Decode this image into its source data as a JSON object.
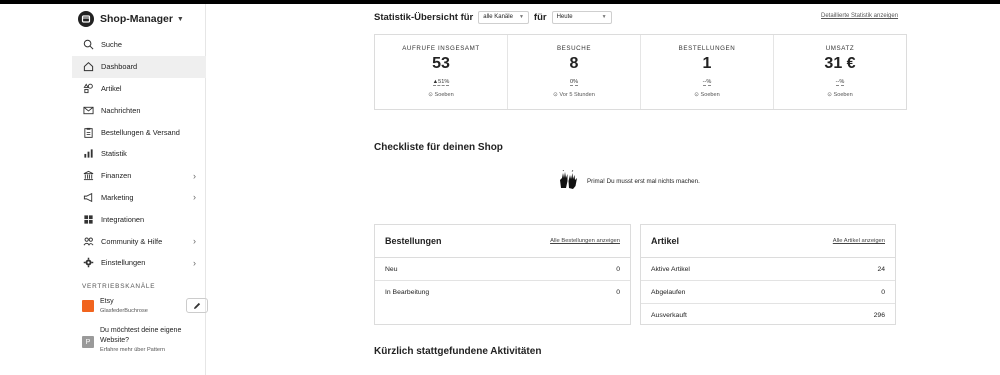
{
  "app": {
    "title": "Shop-Manager"
  },
  "sidebar": {
    "items": [
      {
        "label": "Suche",
        "icon": "search-icon"
      },
      {
        "label": "Dashboard",
        "icon": "home-icon",
        "active": true
      },
      {
        "label": "Artikel",
        "icon": "shapes-icon"
      },
      {
        "label": "Nachrichten",
        "icon": "mail-icon"
      },
      {
        "label": "Bestellungen & Versand",
        "icon": "clipboard-icon"
      },
      {
        "label": "Statistik",
        "icon": "bar-chart-icon"
      },
      {
        "label": "Finanzen",
        "icon": "bank-icon",
        "chevron": "›"
      },
      {
        "label": "Marketing",
        "icon": "megaphone-icon",
        "chevron": "›"
      },
      {
        "label": "Integrationen",
        "icon": "grid-icon"
      },
      {
        "label": "Community & Hilfe",
        "icon": "people-icon",
        "chevron": "›"
      },
      {
        "label": "Einstellungen",
        "icon": "gear-icon",
        "chevron": "›"
      }
    ],
    "section_label": "VERTRIEBSKANÄLE",
    "channel": {
      "name": "Etsy",
      "sub": "GlasfederBuchrose"
    },
    "promo": {
      "badge": "P",
      "text": "Du möchtest deine eigene Website?",
      "sub": "Erfahre mehr über Pattern"
    }
  },
  "stats": {
    "title": "Statistik-Übersicht für",
    "channel_select": "alle Kanäle",
    "for_label": "für",
    "range_select": "Heute",
    "link": "Detaillierte Statistik anzeigen",
    "items": [
      {
        "label": "AUFRUFE INSGESAMT",
        "value": "53",
        "change": "▲51%",
        "time": "⊙ Soeben"
      },
      {
        "label": "BESUCHE",
        "value": "8",
        "change": "0%",
        "time": "⊙ Vor 5 Stunden"
      },
      {
        "label": "BESTELLUNGEN",
        "value": "1",
        "change": "--%",
        "time": "⊙ Soeben"
      },
      {
        "label": "UMSATZ",
        "value": "31 €",
        "change": "--%",
        "time": "⊙ Soeben"
      }
    ]
  },
  "checklist": {
    "title": "Checkliste für deinen Shop",
    "message": "Prima! Du musst erst mal nichts machen."
  },
  "orders_panel": {
    "title": "Bestellungen",
    "link": "Alle Bestellungen anzeigen",
    "rows": [
      {
        "label": "Neu",
        "value": "0"
      },
      {
        "label": "In Bearbeitung",
        "value": "0"
      }
    ]
  },
  "articles_panel": {
    "title": "Artikel",
    "link": "Alle Artikel anzeigen",
    "rows": [
      {
        "label": "Aktive Artikel",
        "value": "24"
      },
      {
        "label": "Abgelaufen",
        "value": "0"
      },
      {
        "label": "Ausverkauft",
        "value": "296"
      }
    ]
  },
  "activity": {
    "title": "Kürzlich stattgefundene Aktivitäten"
  }
}
